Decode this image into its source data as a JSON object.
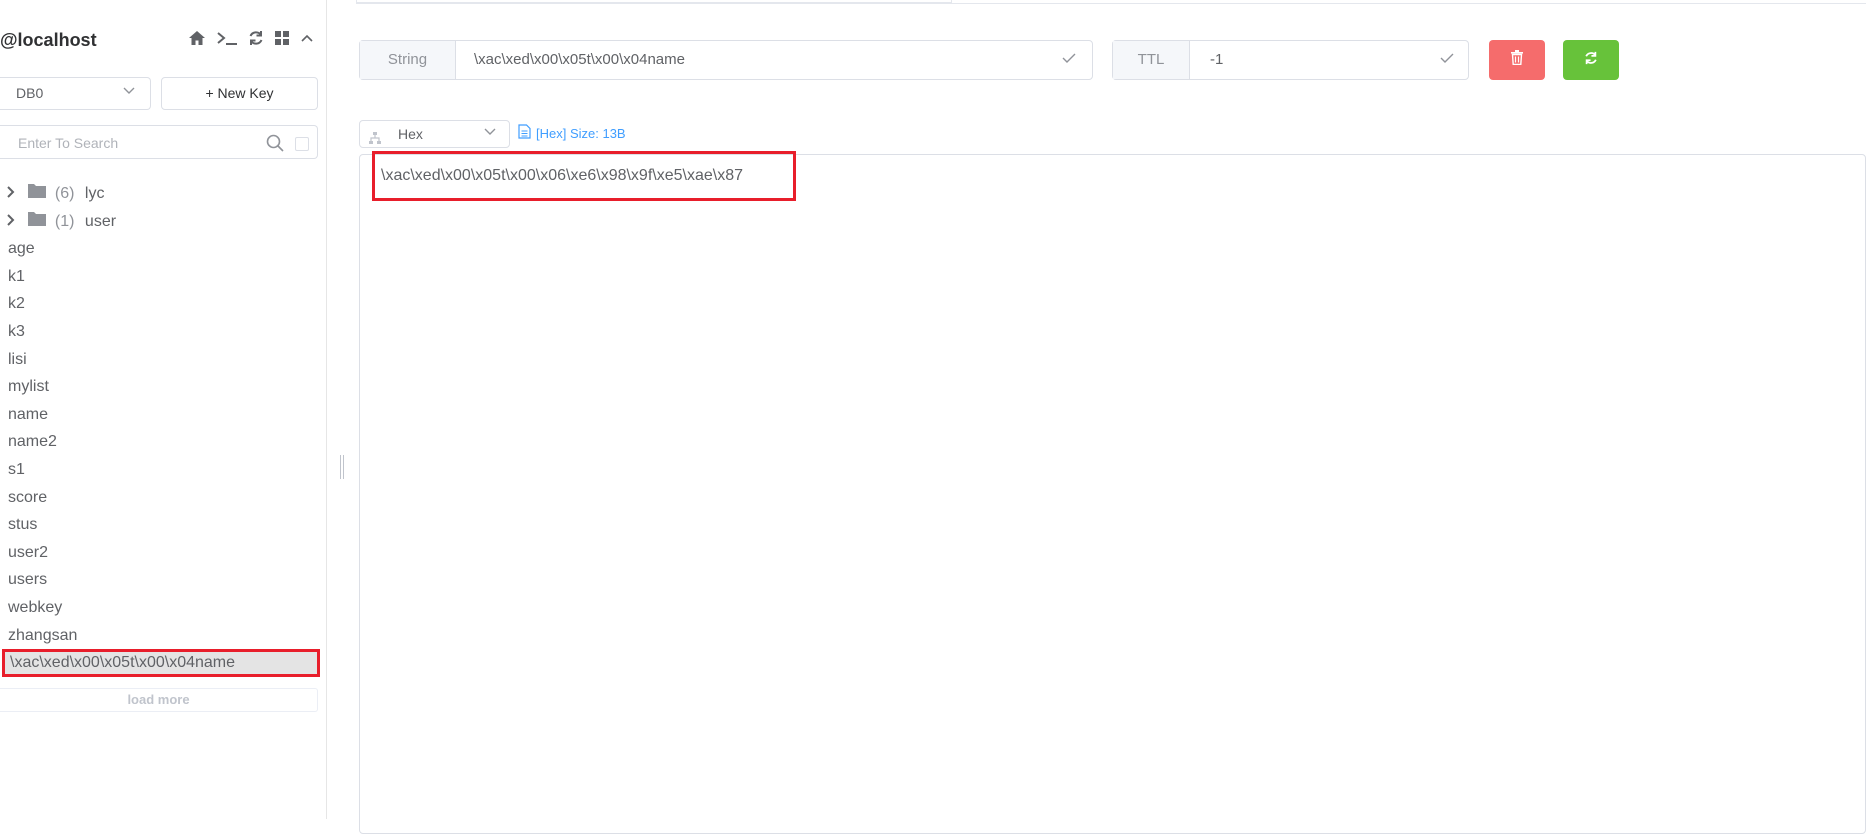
{
  "sidebar": {
    "connection_name": "@localhost",
    "tool_icons": [
      "home-icon",
      "terminal-icon",
      "refresh-icon",
      "grid-icon",
      "chevron-up-icon"
    ],
    "db_select": {
      "value": "DB0"
    },
    "new_key_label": "New Key",
    "search": {
      "placeholder": "Enter To Search"
    },
    "folders": [
      {
        "count": "(6)",
        "name": "lyc"
      },
      {
        "count": "(1)",
        "name": "user"
      }
    ],
    "keys": [
      "age",
      "k1",
      "k2",
      "k3",
      "lisi",
      "mylist",
      "name",
      "name2",
      "s1",
      "score",
      "stus",
      "user2",
      "users",
      "webkey",
      "zhangsan"
    ],
    "selected_key": "\\xac\\xed\\x00\\x05t\\x00\\x04name",
    "load_more_label": "load more"
  },
  "detail": {
    "type_label": "String",
    "key_name": "\\xac\\xed\\x00\\x05t\\x00\\x04name",
    "ttl_label": "TTL",
    "ttl_value": "-1",
    "format_value": "Hex",
    "size_info": "[Hex] Size: 13B",
    "value": "\\xac\\xed\\x00\\x05t\\x00\\x06\\xe6\\x98\\x9f\\xe5\\xae\\x87"
  },
  "colors": {
    "danger": "#f56c6c",
    "success": "#67c23a",
    "primary": "#409eff",
    "highlight_outline": "#e81e2b"
  }
}
